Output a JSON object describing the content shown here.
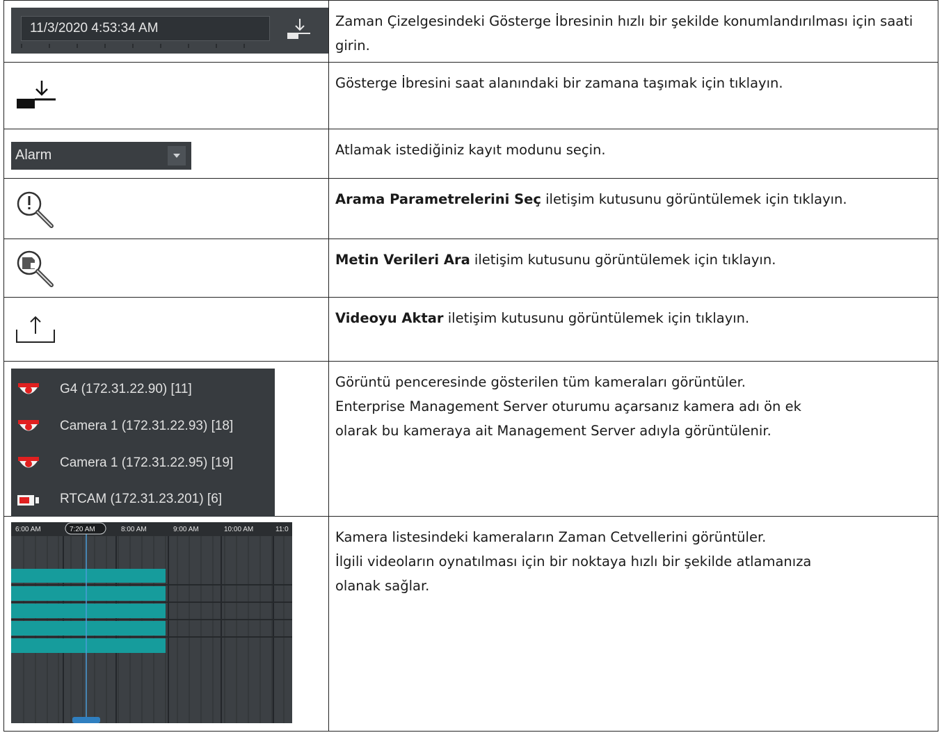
{
  "rows": [
    {
      "ui": {
        "datetime_value": "11/3/2020 4:53:34 AM"
      },
      "icon": "jump-to-time-icon",
      "description": "Zaman Çizelgesindeki Gösterge İbresinin hızlı bir şekilde konumlandırılması için saati girin."
    },
    {
      "icon": "jump-to-time-icon",
      "description": "Gösterge İbresini saat alanındaki bir zamana taşımak için tıklayın."
    },
    {
      "ui": {
        "dropdown_value": "Alarm"
      },
      "icon": "chevron-down-icon",
      "description": "Atlamak istediğiniz kayıt modunu seçin."
    },
    {
      "icon": "search-alert-icon",
      "description_bold": "Arama Parametrelerini Seç",
      "description": " iletişim kutusunu görüntülemek için tıklayın."
    },
    {
      "icon": "search-text-data-icon",
      "description_bold": "Metin Verileri Ara",
      "description": " iletişim kutusunu görüntülemek için tıklayın."
    },
    {
      "icon": "export-icon",
      "description_bold": "Videoyu Aktar",
      "description": " iletişim kutusunu görüntülemek için tıklayın."
    },
    {
      "ui": {
        "cameras": [
          {
            "label": "G4 (172.31.22.90) [11]",
            "icon": "dome-camera-icon"
          },
          {
            "label": "Camera 1 (172.31.22.93) [18]",
            "icon": "dome-camera-icon"
          },
          {
            "label": "Camera 1 (172.31.22.95) [19]",
            "icon": "dome-camera-icon"
          },
          {
            "label": "RTCAM (172.31.23.201) [6]",
            "icon": "box-camera-icon"
          }
        ]
      },
      "description_lines": [
        "Görüntü penceresinde gösterilen tüm kameraları görüntüler.",
        "Enterprise Management Server oturumu açarsanız kamera adı ön ek",
        "olarak bu kameraya ait Management Server adıyla görüntülenir."
      ]
    },
    {
      "ui": {
        "timeline_labels": [
          "6:00 AM",
          "7:20 AM",
          "8:00 AM",
          "9:00 AM",
          "10:00 AM",
          "11:0"
        ],
        "cursor_label": "7:20 AM"
      },
      "description_lines": [
        "Kamera listesindeki kameraların Zaman Cetvellerini görüntüler.",
        "İlgili videoların oynatılması için bir noktaya hızlı bir şekilde atlamanıza",
        "olanak sağlar."
      ]
    }
  ],
  "colors": {
    "panel_dark": "#3c4044",
    "recording_teal": "#169c9c",
    "camera_red": "#e02020",
    "cursor_blue": "#4a9bd6"
  }
}
